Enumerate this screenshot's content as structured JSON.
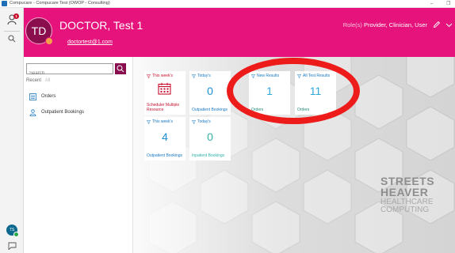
{
  "window": {
    "title": "Compucare - Compucare Test (OWOP - Consulting)",
    "minimize": "–",
    "restore": "❐"
  },
  "rail": {
    "notification_count": "1",
    "user_initials": "TS"
  },
  "header": {
    "initials": "TD",
    "name": "DOCTOR, Test 1",
    "email": "doctortest@1.com",
    "roles_label": "Role(s)",
    "roles_value": "Provider, Clinician, User",
    "bg_color": "#e5137b"
  },
  "panel": {
    "search_placeholder": "Search",
    "recent_label": "Recent",
    "all_label": "All",
    "items": [
      {
        "label": "Orders",
        "icon": "orders-list-icon"
      },
      {
        "label": "Outpatient Bookings",
        "icon": "person-group-icon"
      }
    ]
  },
  "tiles": [
    {
      "header": "This week's",
      "value": "",
      "icon": "calendar-icon",
      "footer": "Scheduler Multiple Resource"
    },
    {
      "header": "Today's",
      "value": "0",
      "footer": "Outpatient Bookings"
    },
    {
      "header": "New Results",
      "value": "1",
      "footer": "Orders"
    },
    {
      "header": "All Test Results",
      "value": "11",
      "footer": "Orders"
    },
    {
      "header": "This week's",
      "value": "4",
      "footer": "Outpatient Bookings"
    },
    {
      "header": "Today's",
      "value": "0",
      "footer": "Inpatient Bookings"
    }
  ],
  "logo": {
    "line1": "STREETS",
    "line2": "HEAVER",
    "line3": "HEALTHCARE",
    "line4": "COMPUTING"
  },
  "colors": {
    "accent": "#e5137b",
    "dark_accent": "#8a0e4e",
    "tile_text": "#1778c3",
    "highlight": "#ee1b1b"
  }
}
